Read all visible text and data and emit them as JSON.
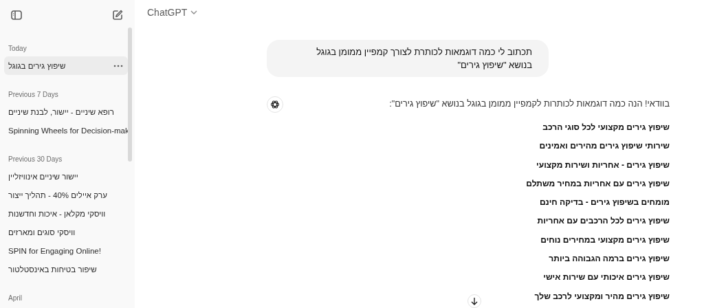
{
  "sidebar": {
    "sections": [
      {
        "title": "Today",
        "items": [
          {
            "title": "שיפוץ גירים בגוגל",
            "selected": true
          }
        ]
      },
      {
        "title": "Previous 7 Days",
        "items": [
          {
            "title": "רופא שיניים - יישור, לבנת שיניים",
            "selected": false
          },
          {
            "title": "Spinning Wheels for Decision-mak",
            "selected": false
          }
        ]
      },
      {
        "title": "Previous 30 Days",
        "items": [
          {
            "title": "יישור שיניים אינוויזליין",
            "selected": false
          },
          {
            "title": "ערק איילים 40% - תהליך ייצור",
            "selected": false
          },
          {
            "title": "וויסקי מקלאן - איכות וחדשנות",
            "selected": false
          },
          {
            "title": "וויסקי סוגים ומארזים",
            "selected": false
          },
          {
            "title": "SPIN for Engaging Online!",
            "selected": false
          },
          {
            "title": "שיפור בטיחות באינסטלטור",
            "selected": false
          }
        ]
      },
      {
        "title": "April"
      }
    ]
  },
  "header": {
    "model": "ChatGPT"
  },
  "messages": [
    {
      "kind": "user",
      "text": "תכתוב לי כמה דוגמאות  לכותרת לצורך קמפיין ממומן בגוגל  בנושא \"שיפוץ גירים\""
    },
    {
      "kind": "assistant",
      "intro": "בוודאי! הנה כמה דוגמאות לכותרות לקמפיין ממומן בגוגל בנושא \"שיפוץ גירים\":",
      "items": [
        "שיפוץ גירים מקצועי לכל סוגי הרכב",
        "שירותי שיפוץ גירים מהירים ואמינים",
        "שיפוץ גירים - אחריות ושירות מקצועי",
        "שיפוץ גירים עם אחריות במחיר משתלם",
        "מומחים בשיפוץ גירים - בדיקה חינם",
        "שיפוץ גירים לכל הרכבים עם אחריות",
        "שיפוץ גירים מקצועי במחירים נוחים",
        "שיפוץ גירים ברמה הגבוהה ביותר",
        "שיפוץ גירים איכותי עם שירות אישי",
        "שיפוץ גירים מהיר ומקצועי לרכב שלך"
      ]
    }
  ]
}
